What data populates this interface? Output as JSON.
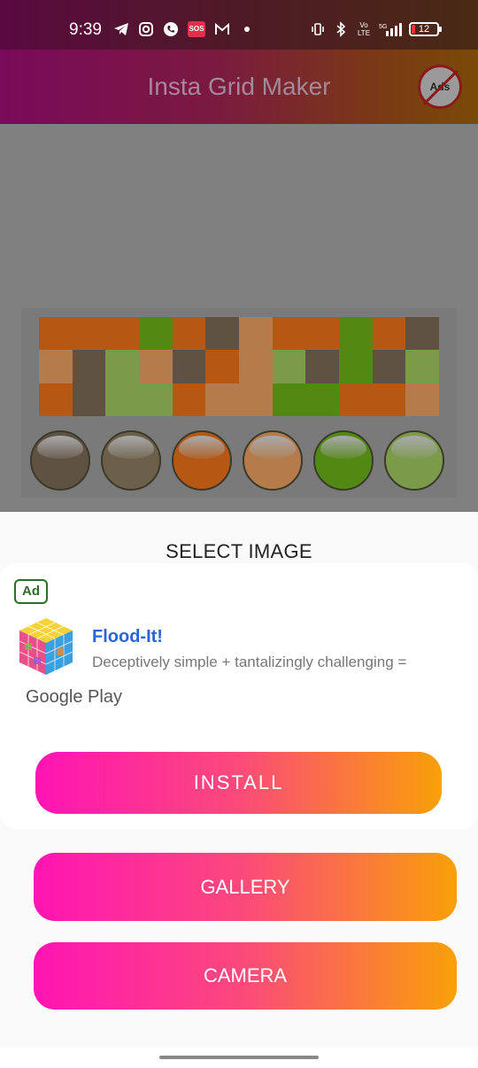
{
  "status_bar": {
    "time": "9:39",
    "left_icons": [
      "telegram-icon",
      "instagram-icon",
      "phone-icon",
      "sos-icon",
      "gmail-icon",
      "more-dot-icon"
    ],
    "sos_label": "SOS",
    "right_icons": [
      "vibrate-icon",
      "bluetooth-icon",
      "volte-icon",
      "signal-5g-icon",
      "battery-icon"
    ],
    "battery_level": "12"
  },
  "app_bar": {
    "title": "Insta Grid Maker",
    "no_ads_label": "Ads"
  },
  "preview": {
    "grid_colors": [
      [
        "#C05000",
        "#C05000",
        "#C05000",
        "#4A8A00",
        "#C05000",
        "#5A4A38",
        "#C07A40",
        "#C05000",
        "#C05000",
        "#4A8A00",
        "#C05000",
        "#5A4A38"
      ],
      [
        "#C07A40",
        "#5A4A38",
        "#7AA040",
        "#C07A40",
        "#5A4A38",
        "#C05000",
        "#C07A40",
        "#7AA040",
        "#5A4A38",
        "#4A8A00",
        "#5A4A38",
        "#7AA040"
      ],
      [
        "#C05000",
        "#5A4A38",
        "#7AA040",
        "#7AA040",
        "#C05000",
        "#C07A40",
        "#C07A40",
        "#4A8A00",
        "#4A8A00",
        "#C05000",
        "#C05000",
        "#C07A40"
      ]
    ],
    "palette_colors": [
      "#5A4A38",
      "#6A5A40",
      "#C05000",
      "#C07A40",
      "#4A8A00",
      "#7AA040"
    ]
  },
  "sheet": {
    "heading": "SELECT IMAGE",
    "ad": {
      "badge": "Ad",
      "title": "Flood-It!",
      "description": "Deceptively simple + tantalizingly challenging =",
      "store": "Google Play",
      "install_label": "INSTALL"
    },
    "gallery_label": "GALLERY",
    "camera_label": "CAMERA"
  }
}
